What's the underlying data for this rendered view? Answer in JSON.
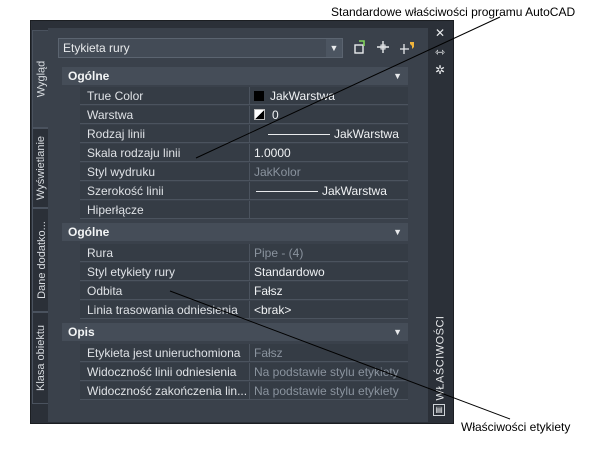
{
  "callouts": {
    "top": "Standardowe właściwości programu AutoCAD",
    "bottom": "Właściwości etykiety"
  },
  "palette": {
    "title": "WŁAŚCIWOŚCI",
    "tabs": [
      "Wygląd",
      "Wyświetlanie",
      "Dane dodatko...",
      "Klasa obiektu"
    ],
    "selector_value": "Etykieta rury",
    "icons": {
      "close": "close-icon",
      "autohide": "autohide-icon",
      "settings": "settings-icon",
      "quick_select": "quick-select-icon",
      "select_objects": "select-objects-icon",
      "toggle_pickadd": "pickadd-icon"
    }
  },
  "sections": [
    {
      "title": "Ogólne",
      "rows": [
        {
          "key": "True Color",
          "value": "JakWarstwa"
        },
        {
          "key": "Warstwa",
          "value": "0"
        },
        {
          "key": "Rodzaj linii",
          "value": "JakWarstwa"
        },
        {
          "key": "Skala rodzaju linii",
          "value": "1.0000"
        },
        {
          "key": "Styl wydruku",
          "value": "JakKolor"
        },
        {
          "key": "Szerokość linii",
          "value": "JakWarstwa"
        },
        {
          "key": "Hiperłącze",
          "value": ""
        }
      ]
    },
    {
      "title": "Ogólne",
      "rows": [
        {
          "key": "Rura",
          "value": "Pipe - (4)"
        },
        {
          "key": "Styl etykiety rury",
          "value": "Standardowo"
        },
        {
          "key": "Odbita",
          "value": "Fałsz"
        },
        {
          "key": "Linia trasowania odniesienia",
          "value": "<brak>"
        }
      ]
    },
    {
      "title": "Opis",
      "rows": [
        {
          "key": "Etykieta jest unieruchomiona",
          "value": "Fałsz"
        },
        {
          "key": "Widoczność linii odniesienia",
          "value": "Na podstawie stylu etykiety"
        },
        {
          "key": "Widoczność zakończenia lin...",
          "value": "Na podstawie stylu etykiety"
        }
      ]
    }
  ]
}
